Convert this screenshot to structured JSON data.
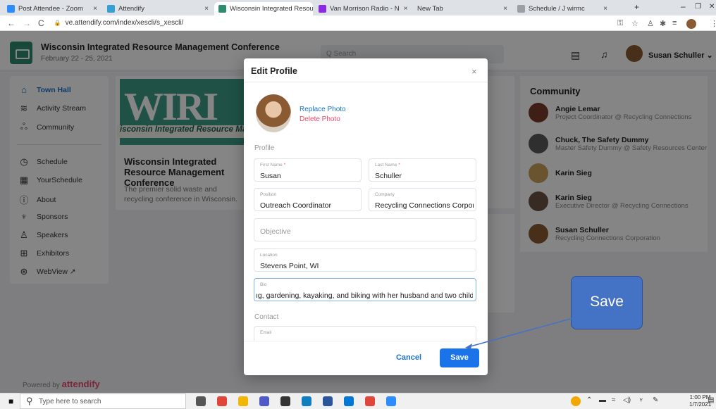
{
  "browser": {
    "tabs": [
      {
        "title": "Post Attendee - Zoom",
        "color": "#2d8cff"
      },
      {
        "title": "Attendify",
        "color": "#34a0d6"
      },
      {
        "title": "Wisconsin Integrated Resou",
        "color": "#2e8b6e"
      },
      {
        "title": "Van Morrison Radio - N",
        "color": "#8a2be2"
      },
      {
        "title": "New Tab",
        "color": ""
      },
      {
        "title": "Schedule / J wirmc",
        "color": "#9aa0a6"
      }
    ],
    "new_tab": "+",
    "controls": {
      "minimize": "–",
      "restore": "❐",
      "close": "✕"
    },
    "url": "ve.attendify.com/index/xescli/s_xescli/",
    "nav": {
      "back": "←",
      "forward": "→",
      "reload": "C"
    }
  },
  "app": {
    "conference_title": "Wisconsin Integrated Resource Management Conference",
    "conference_dates": "February 22 - 25, 2021",
    "search_placeholder": "Q Search",
    "user_name": "Susan Schuller ⌄",
    "sidebar": {
      "items": [
        {
          "label": "Town Hall",
          "icon": "home-icon",
          "glyph": "⌂",
          "active": true
        },
        {
          "label": "Activity Stream",
          "icon": "wifi-icon",
          "glyph": "≋"
        },
        {
          "label": "Community",
          "icon": "people-icon",
          "glyph": "ஃ"
        },
        {
          "label": "Schedule",
          "icon": "clock-icon",
          "glyph": "◷"
        },
        {
          "label": "YourSchedule",
          "icon": "calendar-icon",
          "glyph": "▦"
        },
        {
          "label": "About",
          "icon": "info-icon",
          "glyph": "ⓘ"
        },
        {
          "label": "Sponsors",
          "icon": "trophy-icon",
          "glyph": "♆"
        },
        {
          "label": "Speakers",
          "icon": "speaker-icon",
          "glyph": "♙"
        },
        {
          "label": "Exhibitors",
          "icon": "booth-icon",
          "glyph": "⊞"
        },
        {
          "label": "WebView ↗",
          "icon": "globe-icon",
          "glyph": "⊛"
        }
      ]
    },
    "powered_by": "Powered by",
    "powered_brand": "attendify",
    "banner": {
      "big": "WIRI",
      "strip": "isconsin Integrated Resource Man"
    },
    "card": {
      "title": "Wisconsin Integrated Resource Management Conference",
      "desc": "The premier solid waste and recycling conference in Wisconsin."
    },
    "community": {
      "title": "Community",
      "people": [
        {
          "name": "Angie Lemar",
          "sub": "Project Coordinator @ Recycling Connections",
          "color": "#7a3b2a"
        },
        {
          "name": "Chuck, The Safety Dummy",
          "sub": "Master Safety Dummy @ Safety Resources Center",
          "color": "#5a5a5a"
        },
        {
          "name": "Karin Sieg",
          "sub": "",
          "color": "#c9a25a"
        },
        {
          "name": "Karin Sieg",
          "sub": "Executive Director @ Recycling Connections",
          "color": "#6b5444"
        },
        {
          "name": "Susan Schuller",
          "sub": "Recycling Connections Corporation",
          "color": "#8a5a33"
        }
      ]
    }
  },
  "modal": {
    "title": "Edit Profile",
    "close": "×",
    "replace_photo": "Replace Photo",
    "delete_photo": "Delete Photo",
    "profile_label": "Profile",
    "first_name": {
      "label": "First Name",
      "req": "*",
      "value": "Susan"
    },
    "last_name": {
      "label": "Last Name",
      "req": "*",
      "value": "Schuller"
    },
    "position": {
      "label": "Position",
      "value": "Outreach Coordinator"
    },
    "company": {
      "label": "Company",
      "value": "Recycling Connections Corpora"
    },
    "objective": {
      "placeholder": "Objective"
    },
    "location": {
      "label": "Location",
      "value": "Stevens Point, WI"
    },
    "bio": {
      "label": "Bio",
      "value": "ıg, gardening, kayaking, and biking with her husband and two children"
    },
    "contact_label": "Contact",
    "email": {
      "label": "Email"
    },
    "cancel": "Cancel",
    "save": "Save"
  },
  "callout": {
    "text": "Save",
    "color": "#4472c4"
  },
  "taskbar": {
    "search_placeholder": "Type here to search",
    "time": "1:00 PM",
    "date": "1/7/2021",
    "pinned_icons": [
      "task-view-icon",
      "chrome-icon",
      "file-explorer-icon",
      "teams-icon",
      "store-icon",
      "edge-icon",
      "word-icon",
      "outlook-icon",
      "chrome2-icon",
      "zoom-icon"
    ]
  }
}
